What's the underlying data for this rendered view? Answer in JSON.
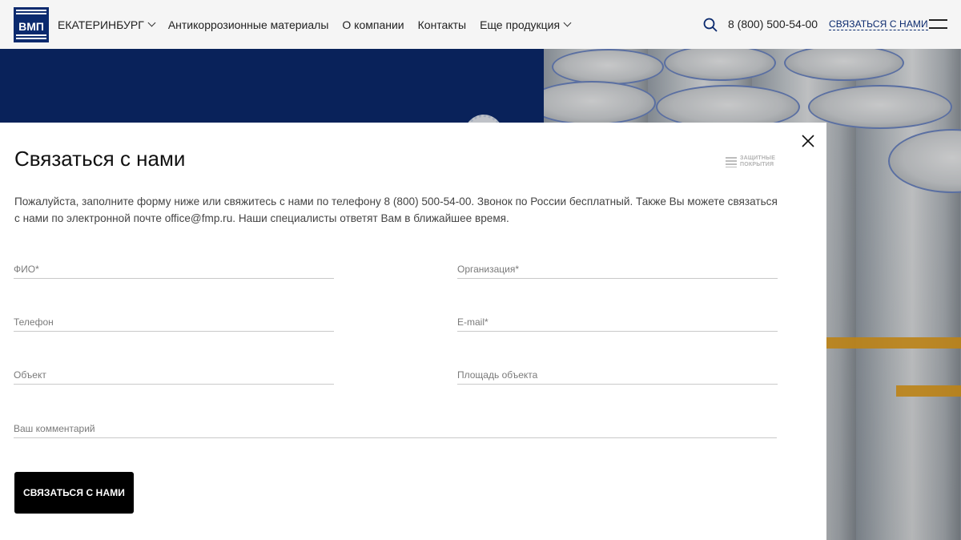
{
  "header": {
    "city": "ЕКАТЕРИНБУРГ",
    "nav": [
      {
        "label": "Антикоррозионные материалы"
      },
      {
        "label": "О компании"
      },
      {
        "label": "Контакты"
      },
      {
        "label": "Еще продукция"
      }
    ],
    "phone": "8 (800) 500-54-00",
    "contact_link": "СВЯЗАТЬСЯ С НАМИ",
    "logo_text": "ВМП"
  },
  "modal": {
    "title": "Связаться с нами",
    "brand_line1": "ЗАЩИТНЫЕ",
    "brand_line2": "ПОКРЫТИЯ",
    "description": "Пожалуйста, заполните форму ниже или свяжитесь с нами по телефону 8 (800) 500-54-00. Звонок по России бесплатный. Также Вы можете связаться с нами по электронной почте office@fmp.ru. Наши специалисты ответят Вам в ближайшее время.",
    "fields": {
      "fio": {
        "placeholder": "ФИО*",
        "value": ""
      },
      "organization": {
        "placeholder": "Организация*",
        "value": ""
      },
      "phone": {
        "placeholder": "Телефон",
        "value": ""
      },
      "email": {
        "placeholder": "E-mail*",
        "value": ""
      },
      "object": {
        "placeholder": "Объект",
        "value": ""
      },
      "area": {
        "placeholder": "Площадь объекта",
        "value": ""
      },
      "comment": {
        "placeholder": "Ваш комментарий",
        "value": ""
      }
    },
    "submit_label": "СВЯЗАТЬСЯ С НАМИ"
  },
  "colors": {
    "brand_blue": "#0b2a6e",
    "button_bg": "#000000",
    "accent_orange": "#e5a01c"
  },
  "icons": [
    "search-icon",
    "close-icon",
    "menu-icon",
    "chevron-down-icon",
    "logo-icon"
  ]
}
